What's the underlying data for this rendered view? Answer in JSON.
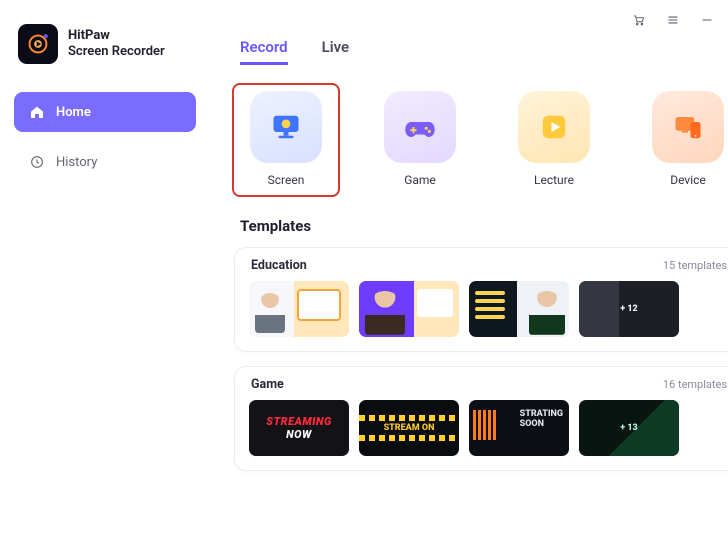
{
  "brand": {
    "line1": "HitPaw",
    "line2": "Screen Recorder"
  },
  "sidebar": {
    "items": [
      {
        "label": "Home"
      },
      {
        "label": "History"
      }
    ]
  },
  "tabs": [
    {
      "label": "Record",
      "active": true
    },
    {
      "label": "Live",
      "active": false
    }
  ],
  "record_tiles": [
    {
      "label": "Screen"
    },
    {
      "label": "Game"
    },
    {
      "label": "Lecture"
    },
    {
      "label": "Device"
    }
  ],
  "templates_heading": "Templates",
  "template_groups": [
    {
      "name": "Education",
      "count_label": "15 templates",
      "more_label": "+ 12",
      "thumbs": [
        "",
        "",
        ""
      ]
    },
    {
      "name": "Game",
      "count_label": "16 templates",
      "more_label": "+ 13",
      "thumb_texts": {
        "t1_a": "STREAMING",
        "t1_b": "NOW",
        "t2": "STREAM ON",
        "t3_a": "STRATING",
        "t3_b": "SOON"
      }
    }
  ]
}
